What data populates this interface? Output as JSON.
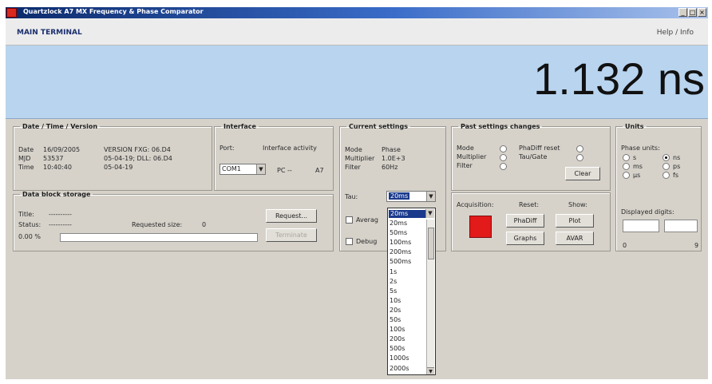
{
  "window": {
    "title": "Quartzlock A7 MX Frequency & Phase Comparator",
    "controls": [
      "_",
      "□",
      "×"
    ]
  },
  "menubar": {
    "left": "MAIN TERMINAL",
    "right": "Help / Info"
  },
  "display": {
    "value": "1.132 ns"
  },
  "date_time_version": {
    "legend": "Date / Time / Version",
    "date_label": "Date",
    "date_value": "16/09/2005",
    "mjd_label": "MJD",
    "mjd_value": "53537",
    "time_label": "Time",
    "time_value": "10:40:40",
    "version_line1": "VERSION FXG: 06.D4",
    "version_line2": "05-04-19; DLL: 06.D4",
    "version_line3": "05-04-19"
  },
  "interface": {
    "legend": "Interface",
    "port_label": "Port:",
    "activity_label": "Interface activity",
    "port_value": "COM1",
    "pc_label": "PC --",
    "device_label": "A7"
  },
  "current_settings": {
    "legend": "Current settings",
    "mode_label": "Mode",
    "mode_value": "Phase",
    "multiplier_label": "Multiplier",
    "multiplier_value": "1.0E+3",
    "filter_label": "Filter",
    "filter_value": "60Hz",
    "tau_label": "Tau:",
    "tau_value": "20ms",
    "averaging_label": "Averag",
    "debug_label": "Debug"
  },
  "past_settings": {
    "legend": "Past settings changes",
    "mode_label": "Mode",
    "multiplier_label": "Multiplier",
    "filter_label": "Filter",
    "phadiff_reset_label": "PhaDiff reset",
    "tau_gate_label": "Tau/Gate",
    "clear_button": "Clear"
  },
  "units": {
    "legend": "Units",
    "phase_units_label": "Phase units:",
    "options": [
      "s",
      "ns",
      "ms",
      "ps",
      "µs",
      "fs"
    ],
    "selected": "ns",
    "displayed_digits_label": "Displayed digits:",
    "digits_min": "0",
    "digits_max": "9"
  },
  "data_block": {
    "legend": "Data block storage",
    "title_label": "Title:",
    "title_value": "----------",
    "status_label": "Status:",
    "status_value": "----------",
    "requested_size_label": "Requested size:",
    "requested_size_value": "0",
    "progress_text": "0.00 %",
    "progress": 0.0,
    "request_button": "Request...",
    "terminate_button": "Terminate"
  },
  "acquisition": {
    "acquisition_label": "Acquisition:",
    "reset_label": "Reset:",
    "show_label": "Show:",
    "phadiff_button": "PhaDiff",
    "graphs_button": "Graphs",
    "plot_button": "Plot",
    "avar_button": "AVAR",
    "indicator_color": "#e21a1a"
  },
  "tau_dropdown": {
    "current": "20ms",
    "items": [
      "20ms",
      "50ms",
      "100ms",
      "200ms",
      "500ms",
      "1s",
      "2s",
      "5s",
      "10s",
      "20s",
      "50s",
      "100s",
      "200s",
      "500s",
      "1000s",
      "2000s"
    ]
  }
}
